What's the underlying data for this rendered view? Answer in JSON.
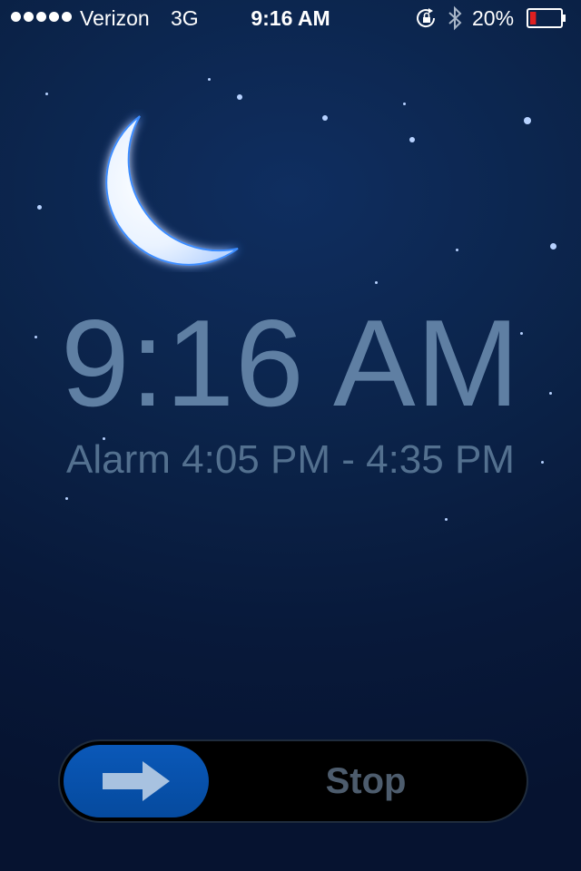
{
  "status_bar": {
    "carrier": "Verizon",
    "network": "3G",
    "time": "9:16 AM",
    "battery_percent": "20%",
    "battery_level": 0.2,
    "icons": [
      "signal-dots",
      "rotation-lock-icon",
      "bluetooth-icon",
      "battery-icon"
    ]
  },
  "clock": {
    "time": "9:16 AM",
    "alarm_range": "Alarm 4:05 PM - 4:35 PM"
  },
  "slider": {
    "label": "Stop",
    "knob_icon": "arrow-right-icon"
  },
  "colors": {
    "background": "#0b2349",
    "clock_text": "#5f7fa3",
    "knob": "#0a58b8",
    "battery_low": "#e02020"
  }
}
